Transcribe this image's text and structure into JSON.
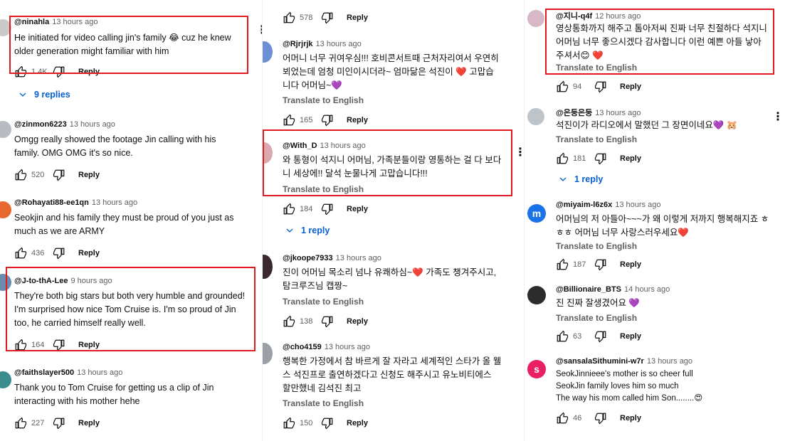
{
  "columns": [
    {
      "comments": [
        {
          "handle": "@ninahla",
          "time": "13 hours ago",
          "text": "He initiated for video calling jin's family 😂 cuz he knew older generation might familiar with him",
          "likes": "1.4K",
          "reply": "Reply",
          "replies": "9 replies"
        },
        {
          "handle": "@zinmon6223",
          "time": "13 hours ago",
          "text": "Omgg really showed the footage Jin calling with his family. OMG OMG it's so nice.",
          "likes": "520",
          "reply": "Reply"
        },
        {
          "handle": "@Rohayati88-ee1qn",
          "time": "13 hours ago",
          "text": "Seokjin and his family they must be proud of you just as much as we are ARMY",
          "likes": "436",
          "reply": "Reply"
        },
        {
          "handle": "@J-to-thA-Lee",
          "time": "9 hours ago",
          "text": "They're both big stars but both very humble and grounded! I'm surprised how nice Tom Cruise is. I'm so proud of Jin too, he carried himself really well.",
          "likes": "164",
          "reply": "Reply"
        },
        {
          "handle": "@faithslayer500",
          "time": "13 hours ago",
          "text": "Thank you to Tom Cruise for getting us a clip of Jin interacting with his mother hehe",
          "likes": "227",
          "reply": "Reply"
        }
      ]
    },
    {
      "comments": [
        {
          "likes": "578",
          "reply": "Reply"
        },
        {
          "handle": "@Rjrjrjk",
          "time": "13 hours ago",
          "text": "어머니 너무 귀여우심!!! 호비콘서트때 근처자리여서 우연히 뵈었는데 엄청 미인이시더라~ 엄마닮은 석진이 ❤️ 고맙습니다 어머님~💜",
          "translate": "Translate to English",
          "likes": "165",
          "reply": "Reply"
        },
        {
          "handle": "@With_D",
          "time": "13 hours ago",
          "text": "와 통형이 석지니 어머님, 가족분들이랑 영통하는 걸 다 보다니 세상에!! 달석 눈물나게 고맙습니다!!!",
          "translate": "Translate to English",
          "likes": "184",
          "reply": "Reply",
          "replies": "1 reply"
        },
        {
          "handle": "@jkoope7933",
          "time": "13 hours ago",
          "text": "진이 어머님 목소리 넘나 유쾌하심~❤️ 가족도 챙겨주시고, 탐크루즈님 캡짱~",
          "translate": "Translate to English",
          "likes": "138",
          "reply": "Reply"
        },
        {
          "handle": "@cho4159",
          "time": "13 hours ago",
          "text": "행복한 가정에서 참 바르게 잘 자라고 세계적인 스타가 올 웰스 석진프로 출연하겠다고 신청도 해주시고 유노비티에스 할만했네 김석진 최고",
          "translate": "Translate to English",
          "likes": "150",
          "reply": "Reply"
        }
      ]
    },
    {
      "comments": [
        {
          "handle": "@지니-q4f",
          "time": "12 hours ago",
          "text": "영상통화까지 해주고 톰아저씨 진짜 너무 친절하다 석지니 어머님 너무 좋으시겠다 감사합니다 이런 예쁜 아들 낳아주셔서😊 ❤️",
          "translate": "Translate to English",
          "likes": "94",
          "reply": "Reply"
        },
        {
          "handle": "@은둥은둥",
          "time": "13 hours ago",
          "text": "석진이가 라디오에서 말했던 그 장면이네요💜 🐹",
          "translate": "Translate to English",
          "likes": "181",
          "reply": "Reply",
          "replies": "1 reply"
        },
        {
          "handle": "@miyaim-l6z6x",
          "time": "13 hours ago",
          "avatar_letter": "m",
          "text": "어머님의 저 아들아~~~가 왜 이렇게 저까지 행복해지죠 ㅎㅎㅎ 어머님 너무 사랑스러우세요❤️",
          "translate": "Translate to English",
          "likes": "187",
          "reply": "Reply"
        },
        {
          "handle": "@Billionaire_BTS",
          "time": "14 hours ago",
          "text": "진 진짜 잘생겼어요 💜",
          "translate": "Translate to English",
          "likes": "63",
          "reply": "Reply"
        },
        {
          "handle": "@sansalaSithumini-w7r",
          "time": "13 hours ago",
          "avatar_letter": "s",
          "text": "SeokJinnieee's mother is so cheer full\nSeokJin family loves him so much\nThe way his mom called him Son........😍",
          "likes": "46",
          "reply": "Reply"
        }
      ]
    }
  ],
  "colors": {
    "highlight": "#e01b22",
    "link": "#065fd4",
    "muted": "#606060",
    "avatar_m": "#1a73e8",
    "avatar_s": "#e91e63"
  }
}
